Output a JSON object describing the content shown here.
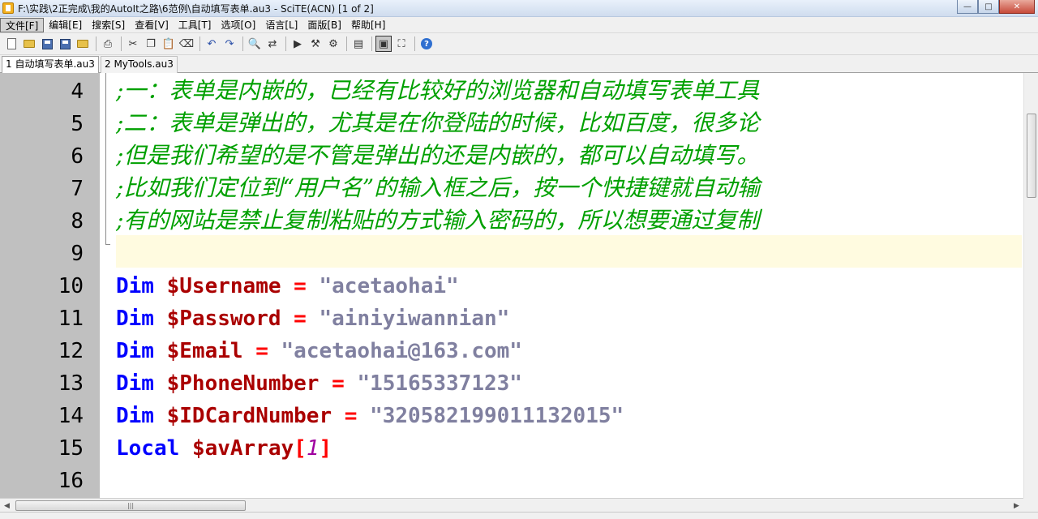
{
  "window": {
    "title": "F:\\实践\\2正完成\\我的AutoIt之路\\6范例\\自动填写表单.au3 - SciTE(ACN) [1 of 2]",
    "controls": {
      "minimize": "—",
      "maximize": "□",
      "close": "✕"
    }
  },
  "menu": [
    "文件[F]",
    "编辑[E]",
    "搜索[S]",
    "查看[V]",
    "工具[T]",
    "选项[O]",
    "语言[L]",
    "面版[B]",
    "帮助[H]"
  ],
  "toolbar": {
    "icons": [
      "new-file",
      "open-folder",
      "save",
      "save-all",
      "open-recent",
      "print",
      "cut",
      "copy",
      "paste",
      "delete",
      "undo",
      "redo",
      "find",
      "replace",
      "run",
      "compile",
      "build",
      "toggle-panel",
      "console",
      "fullscreen",
      "help"
    ]
  },
  "tabs": [
    {
      "label": "1 自动填写表单.au3",
      "active": true
    },
    {
      "label": "2 MyTools.au3",
      "active": false
    }
  ],
  "editor": {
    "comment_lines": [
      {
        "number": "4",
        "text": ";一：表单是内嵌的，已经有比较好的浏览器和自动填写表单工具"
      },
      {
        "number": "5",
        "text": ";二：表单是弹出的，尤其是在你登陆的时候，比如百度，很多论"
      },
      {
        "number": "6",
        "text": ";但是我们希望的是不管是弹出的还是内嵌的，都可以自动填写。"
      },
      {
        "number": "7",
        "text": ";比如我们定位到“用户名”的输入框之后，按一个快捷键就自动输"
      },
      {
        "number": "8",
        "text": ";有的网站是禁止复制粘贴的方式输入密码的，所以想要通过复制"
      }
    ],
    "blank_lines": {
      "l9": "9",
      "l16": "16"
    },
    "dim_lines": [
      {
        "number": "10",
        "keyword": "Dim",
        "variable": "$Username",
        "operator": "=",
        "value": "\"acetaohai\""
      },
      {
        "number": "11",
        "keyword": "Dim",
        "variable": "$Password",
        "operator": "=",
        "value": "\"ainiyiwannian\""
      },
      {
        "number": "12",
        "keyword": "Dim",
        "variable": "$Email",
        "operator": "=",
        "value": "\"acetaohai@163.com\""
      },
      {
        "number": "13",
        "keyword": "Dim",
        "variable": "$PhoneNumber",
        "operator": "=",
        "value": "\"15165337123\""
      },
      {
        "number": "14",
        "keyword": "Dim",
        "variable": "$IDCardNumber",
        "operator": "=",
        "value": "\"320582199011132015\""
      }
    ],
    "local_line": {
      "number": "15",
      "keyword": "Local",
      "variable": "$avArray",
      "open": "[",
      "index": "1",
      "close": "]"
    }
  },
  "colors": {
    "comment": "#00a000",
    "keyword": "#0000ff",
    "variable": "#aa0000",
    "operator": "#ff0000",
    "string": "#8080a0",
    "number": "#a000a0",
    "caret_line": "#fffbe0",
    "gutter": "#c0c0c0"
  }
}
